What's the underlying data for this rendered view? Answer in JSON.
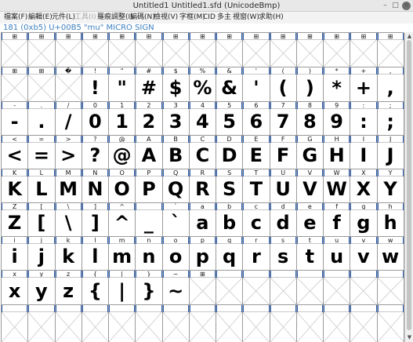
{
  "window": {
    "title": "Untitled1  Untitled1.sfd (UnicodeBmp)",
    "minimize_glyph": "–",
    "maximize_glyph": "□",
    "close_glyph": "×"
  },
  "menu": [
    {
      "label": "檔案(F)",
      "disabled": false
    },
    {
      "label": "編輯(E)",
      "disabled": false
    },
    {
      "label": "元件(L)",
      "disabled": false
    },
    {
      "label": "工具(I)",
      "disabled": true
    },
    {
      "label": "羅痕調整(I)",
      "disabled": false
    },
    {
      "label": "編碼(N)",
      "disabled": false
    },
    {
      "label": "檢視(V)",
      "disabled": false
    },
    {
      "label": "字框(M)",
      "disabled": false
    },
    {
      "label": "CID",
      "disabled": false
    },
    {
      "label": "多主",
      "disabled": false
    },
    {
      "label": "視窗(W)",
      "disabled": false
    },
    {
      "label": "求助(H)",
      "disabled": false
    }
  ],
  "glyph_info": "181 (0xb5) U+00B5 \"mu\" MICRO SIGN",
  "missing_label": "⊞",
  "rows": [
    {
      "labels": [
        "⊞",
        "⊞",
        "⊞",
        "⊞",
        "⊞",
        "⊞",
        "⊞",
        "⊞",
        "⊞",
        "⊞",
        "⊞",
        "⊞",
        "⊞",
        "⊞",
        "⊞"
      ],
      "glyphs": [
        "",
        "",
        "",
        "",
        "",
        "",
        "",
        "",
        "",
        "",
        "",
        "",
        "",
        "",
        ""
      ]
    },
    {
      "labels": [
        "⊞",
        "⊞",
        "�",
        "!",
        "\"",
        "#",
        "$",
        "%",
        "&",
        "'",
        "(",
        ")",
        "*",
        "+",
        ","
      ],
      "glyphs": [
        "",
        "",
        "",
        "!",
        "\"",
        "#",
        "$",
        "%",
        "&",
        "'",
        "(",
        ")",
        "*",
        "+",
        ","
      ]
    },
    {
      "labels": [
        "-",
        ".",
        "/",
        "0",
        "1",
        "2",
        "3",
        "4",
        "5",
        "6",
        "7",
        "8",
        "9",
        ":",
        ";"
      ],
      "glyphs": [
        "-",
        ".",
        "/",
        "0",
        "1",
        "2",
        "3",
        "4",
        "5",
        "6",
        "7",
        "8",
        "9",
        ":",
        ";"
      ]
    },
    {
      "labels": [
        "<",
        "=",
        ">",
        "?",
        "@",
        "A",
        "B",
        "C",
        "D",
        "E",
        "F",
        "G",
        "H",
        "I",
        "J"
      ],
      "glyphs": [
        "<",
        "=",
        ">",
        "?",
        "@",
        "A",
        "B",
        "C",
        "D",
        "E",
        "F",
        "G",
        "H",
        "I",
        "J"
      ]
    },
    {
      "labels": [
        "K",
        "L",
        "M",
        "N",
        "O",
        "P",
        "Q",
        "R",
        "S",
        "T",
        "U",
        "V",
        "W",
        "X",
        "Y"
      ],
      "glyphs": [
        "K",
        "L",
        "M",
        "N",
        "O",
        "P",
        "Q",
        "R",
        "S",
        "T",
        "U",
        "V",
        "W",
        "X",
        "Y"
      ]
    },
    {
      "labels": [
        "Z",
        "[",
        "\\",
        "]",
        "^",
        "_",
        "`",
        "a",
        "b",
        "c",
        "d",
        "e",
        "f",
        "g",
        "h"
      ],
      "glyphs": [
        "Z",
        "[",
        "\\",
        "]",
        "^",
        "_",
        "`",
        "a",
        "b",
        "c",
        "d",
        "e",
        "f",
        "g",
        "h"
      ]
    },
    {
      "labels": [
        "i",
        "j",
        "k",
        "l",
        "m",
        "n",
        "o",
        "p",
        "q",
        "r",
        "s",
        "t",
        "u",
        "v",
        "w"
      ],
      "glyphs": [
        "i",
        "j",
        "k",
        "l",
        "m",
        "n",
        "o",
        "p",
        "q",
        "r",
        "s",
        "t",
        "u",
        "v",
        "w"
      ]
    },
    {
      "labels": [
        "x",
        "y",
        "z",
        "{",
        "|",
        "}",
        "~",
        "⊞",
        "",
        "",
        "",
        "",
        "",
        "",
        ""
      ],
      "glyphs": [
        "x",
        "y",
        "z",
        "{",
        "|",
        "}",
        "~",
        "",
        "",
        "",
        "",
        "",
        "",
        "",
        ""
      ]
    },
    {
      "labels": [
        "",
        "",
        "",
        "",
        "",
        "",
        "",
        "",
        "",
        "",
        "",
        "",
        "",
        "",
        ""
      ],
      "glyphs": [
        "",
        "",
        "",
        "",
        "",
        "",
        "",
        "",
        "",
        "",
        "",
        "",
        "",
        "",
        ""
      ]
    }
  ]
}
